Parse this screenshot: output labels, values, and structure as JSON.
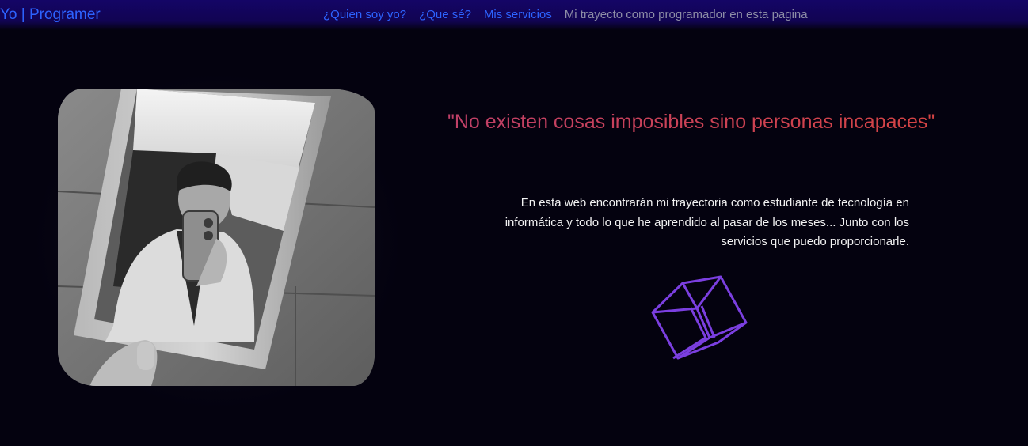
{
  "navbar": {
    "brand": "Yo | Programer",
    "links": [
      {
        "label": "¿Quien soy yo?"
      },
      {
        "label": "¿Que sé?"
      },
      {
        "label": "Mis servicios"
      },
      {
        "label": "Mi trayecto como programador en esta pagina"
      }
    ]
  },
  "hero": {
    "quote": "\"No existen cosas imposibles sino personas incapaces\"",
    "intro": "En esta web encontrarán mi trayectoria como estudiante de tecnología en informática y todo lo que he aprendido al pasar de los meses... Junto con los servicios que puedo proporcionarle.",
    "photo_alt": "profile photo",
    "cube_icon": "wireframe-cube-icon"
  },
  "colors": {
    "navbar_bg": "#140566",
    "link": "#2d63ff",
    "link_muted": "#8d8da6",
    "page_bg": "#04020f",
    "quote_gradient": [
      "#c04068",
      "#d8443f"
    ],
    "cube_stroke": "#7b3fe0"
  }
}
